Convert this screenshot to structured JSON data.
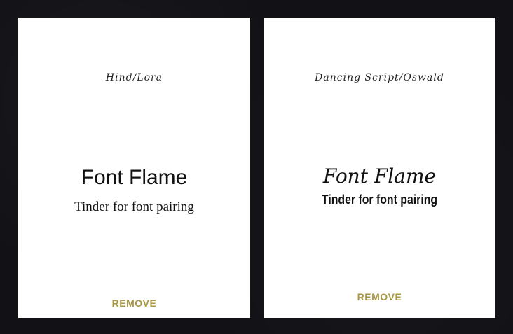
{
  "cards": [
    {
      "pair_name": "Hind/Lora",
      "headline": "Font Flame",
      "tagline": "Tinder for font pairing",
      "remove_label": "REMOVE"
    },
    {
      "pair_name": "Dancing Script/Oswald",
      "headline": "Font Flame",
      "tagline": "Tinder for font pairing",
      "remove_label": "REMOVE"
    }
  ],
  "colors": {
    "background": "#121216",
    "card": "#ffffff",
    "accent": "#a99744"
  }
}
